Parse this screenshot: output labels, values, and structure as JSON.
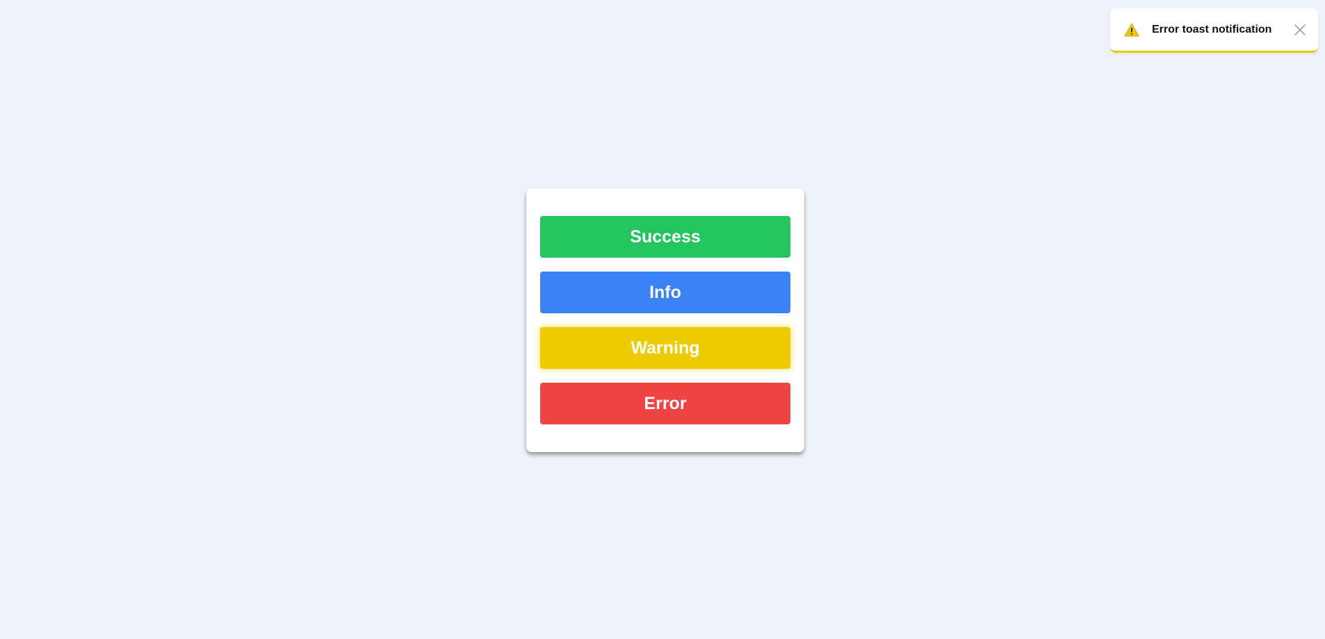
{
  "buttons": {
    "success": "Success",
    "info": "Info",
    "warning": "Warning",
    "error": "Error"
  },
  "toast": {
    "message": "Error toast notification",
    "icon": "warning-triangle-icon",
    "close_icon": "close-icon"
  },
  "colors": {
    "background": "#eef2fb",
    "success": "#22c55e",
    "info": "#3b82f6",
    "warning": "#eecb00",
    "error": "#ef4444"
  }
}
